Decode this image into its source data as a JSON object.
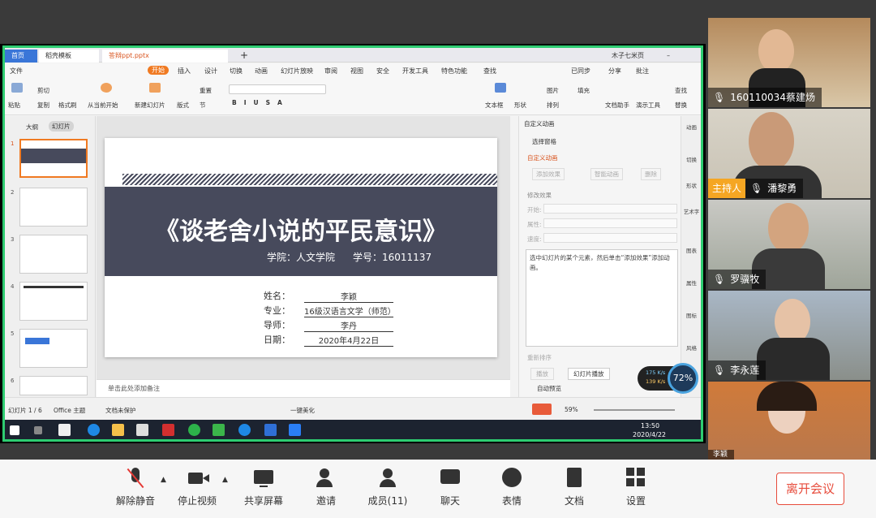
{
  "wps": {
    "tabs": [
      "首页",
      "稻壳模板",
      "答辩ppt.pptx"
    ],
    "user": "木子七米页",
    "menus": [
      "文件",
      "开始",
      "插入",
      "设计",
      "切换",
      "动画",
      "幻灯片放映",
      "审阅",
      "视图",
      "安全",
      "开发工具",
      "特色功能",
      "查找"
    ],
    "menu_right": [
      "已同步",
      "分享",
      "批注"
    ],
    "ribbon": {
      "paste": "粘贴",
      "cut": "剪切",
      "copy": "复制",
      "format_painter": "格式刷",
      "from_current": "从当前开始",
      "new_slide": "新建幻灯片",
      "layout": "版式",
      "section": "节",
      "reset": "重置",
      "textbox": "文本框",
      "shape": "形状",
      "arrange": "排列",
      "picture": "图片",
      "fill": "填充",
      "find": "查找",
      "replace": "替换",
      "text_helper": "文档助手",
      "presentation_tools": "演示工具"
    },
    "left_tabs": [
      "大纲",
      "幻灯片"
    ],
    "slide_numbers": [
      "1",
      "2",
      "3",
      "4",
      "5",
      "6"
    ],
    "slide": {
      "title": "《谈老舍小说的平民意识》",
      "college": "学院：人文学院",
      "student_id": "学号：16011137",
      "fields": [
        {
          "label": "姓名：",
          "value": "李颖"
        },
        {
          "label": "专业：",
          "value": "16级汉语言文学（师范）"
        },
        {
          "label": "导师：",
          "value": "李丹"
        },
        {
          "label": "日期：",
          "value": "2020年4月22日"
        }
      ]
    },
    "notes_placeholder": "单击此处添加备注",
    "pane": {
      "title": "自定义动画",
      "select_pane": "选择窗格",
      "custom_anim": "自定义动画",
      "add_effect": "添加效果",
      "smart_anim": "智能动画",
      "delete": "删除",
      "modify": "修改效果",
      "start": "开始:",
      "property": "属性:",
      "speed": "速度:",
      "hint": "选中幻灯片的某个元素，然后单击“添加效果”添加动画。",
      "reorder": "重新排序",
      "play": "播放",
      "slideshow": "幻灯片播放",
      "autopreview": "自动预览"
    },
    "right_tools": [
      "动画",
      "切换",
      "形状",
      "艺术字",
      "图表",
      "属性",
      "图标",
      "风格"
    ],
    "status": {
      "slide_of": "幻灯片 1 / 6",
      "theme": "Office 主题",
      "protect": "文档未保护",
      "beautify": "一键美化",
      "zoom": "59%"
    },
    "net_speed_up": "175 K/s",
    "net_speed_down": "139 K/s",
    "cpu": "72%",
    "clock_time": "13:50",
    "clock_date": "2020/4/22"
  },
  "participants": [
    {
      "name": "160110034蔡建炀",
      "host": false
    },
    {
      "name": "潘黎勇",
      "host": true,
      "host_label": "主持人"
    },
    {
      "name": "罗骥牧",
      "host": false
    },
    {
      "name": "李永莲",
      "host": false
    },
    {
      "name": "李颖",
      "host": false
    }
  ],
  "toolbar": {
    "buttons": [
      "解除静音",
      "停止视频",
      "共享屏幕",
      "邀请",
      "成员(11)",
      "聊天",
      "表情",
      "文档",
      "设置"
    ],
    "leave": "离开会议"
  }
}
